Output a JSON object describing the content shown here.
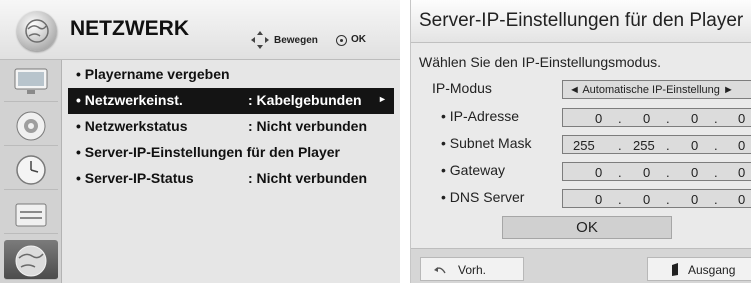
{
  "left": {
    "title": "NETZWERK",
    "nav_hint": "Bewegen",
    "ok_hint": "OK",
    "menu": [
      {
        "label": "• Playername vergeben",
        "value": ""
      },
      {
        "label": "• Netzwerkeinst.",
        "value": ": Kabelgebunden",
        "selected": true
      },
      {
        "label": "• Netzwerkstatus",
        "value": ": Nicht verbunden"
      },
      {
        "label": "• Server-IP-Einstellungen für den Player",
        "value": ""
      },
      {
        "label": "• Server-IP-Status",
        "value": ": Nicht verbunden"
      }
    ],
    "sidebar_icons": [
      "monitor-icon",
      "disc-icon",
      "clock-icon",
      "toolbox-icon",
      "globe-icon"
    ]
  },
  "right": {
    "title": "Server-IP-Einstellungen für den Player",
    "prompt": "Wählen Sie den IP-Einstellungsmodus.",
    "mode_label": "IP-Modus",
    "mode_value": "◄ Automatische IP-Einstellung ►",
    "rows": [
      {
        "label": "• IP-Adresse",
        "octets": [
          "0",
          "0",
          "0",
          "0"
        ]
      },
      {
        "label": "• Subnet Mask",
        "octets": [
          "255",
          "255",
          "0",
          "0"
        ]
      },
      {
        "label": "• Gateway",
        "octets": [
          "0",
          "0",
          "0",
          "0"
        ]
      },
      {
        "label": "• DNS Server",
        "octets": [
          "0",
          "0",
          "0",
          "0"
        ]
      }
    ],
    "ok_button": "OK",
    "back_button": "Vorh.",
    "exit_button": "Ausgang"
  }
}
